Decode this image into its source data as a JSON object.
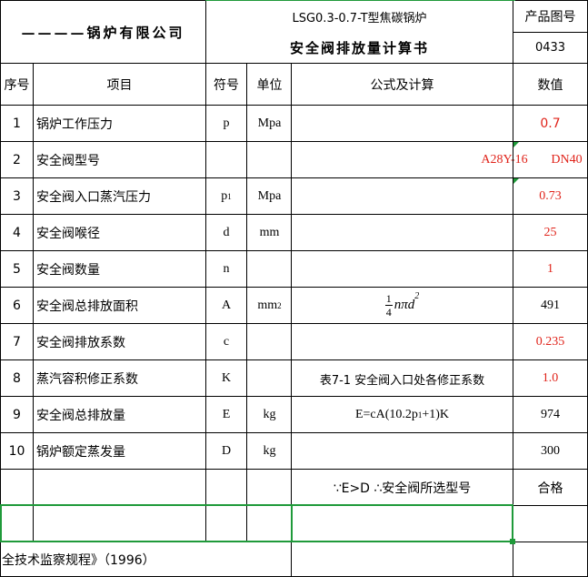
{
  "header": {
    "company": "————锅炉有限公司",
    "model_title": "LSG0.3-0.7-T型焦碳锅炉",
    "doc_title": "安全阀排放量计算书",
    "product_no_label": "产品图号",
    "product_no": "0433"
  },
  "columns": {
    "index": "序号",
    "item": "项目",
    "symbol": "符号",
    "unit": "单位",
    "formula": "公式及计算",
    "value": "数值"
  },
  "rows": [
    {
      "no": "1",
      "item": "锅炉工作压力",
      "symbol": "p",
      "unit": "Mpa",
      "formula": "",
      "value": "0.7"
    },
    {
      "no": "2",
      "item": "安全阀型号",
      "symbol": "",
      "unit": "",
      "formula": "",
      "value": "",
      "model_a": "A28Y-16",
      "model_b": "DN40"
    },
    {
      "no": "3",
      "item": "安全阀入口蒸汽压力",
      "symbol": "p",
      "symbol_sub": "1",
      "unit": "Mpa",
      "formula": "",
      "value": "0.73"
    },
    {
      "no": "4",
      "item": "安全阀喉径",
      "symbol": "d",
      "unit": "mm",
      "formula": "",
      "value": "25"
    },
    {
      "no": "5",
      "item": "安全阀数量",
      "symbol": "n",
      "unit": "",
      "formula": "",
      "value": "1"
    },
    {
      "no": "6",
      "item": "安全阀总排放面积",
      "symbol": "A",
      "unit": "mm",
      "unit_sup": "2",
      "formula_num": "1",
      "formula_den": "4",
      "formula_expr": "nπd",
      "formula_sup": "2",
      "value": "491"
    },
    {
      "no": "7",
      "item": "安全阀排放系数",
      "symbol": "c",
      "unit": "",
      "formula": "",
      "value": "0.235"
    },
    {
      "no": "8",
      "item": "蒸汽容积修正系数",
      "symbol": "K",
      "unit": "",
      "formula": "表7-1 安全阀入口处各修正系数",
      "value": "1.0"
    },
    {
      "no": "9",
      "item": "安全阀总排放量",
      "symbol": "E",
      "unit": "kg",
      "formula_pre": "E=cA(10.2p",
      "formula_sub": "1",
      "formula_post": "+1)K",
      "value": "974"
    },
    {
      "no": "10",
      "item": "锅炉额定蒸发量",
      "symbol": "D",
      "unit": "kg",
      "formula": "",
      "value": "300"
    }
  ],
  "conclusion": {
    "text": "∵E>D  ∴安全阀所选型号",
    "result": "合格"
  },
  "footnote": "全技术监察规程》（1996）",
  "colors": {
    "grid": "#000000",
    "selection": "#1f9a3a",
    "value_red": "#e0231a"
  }
}
